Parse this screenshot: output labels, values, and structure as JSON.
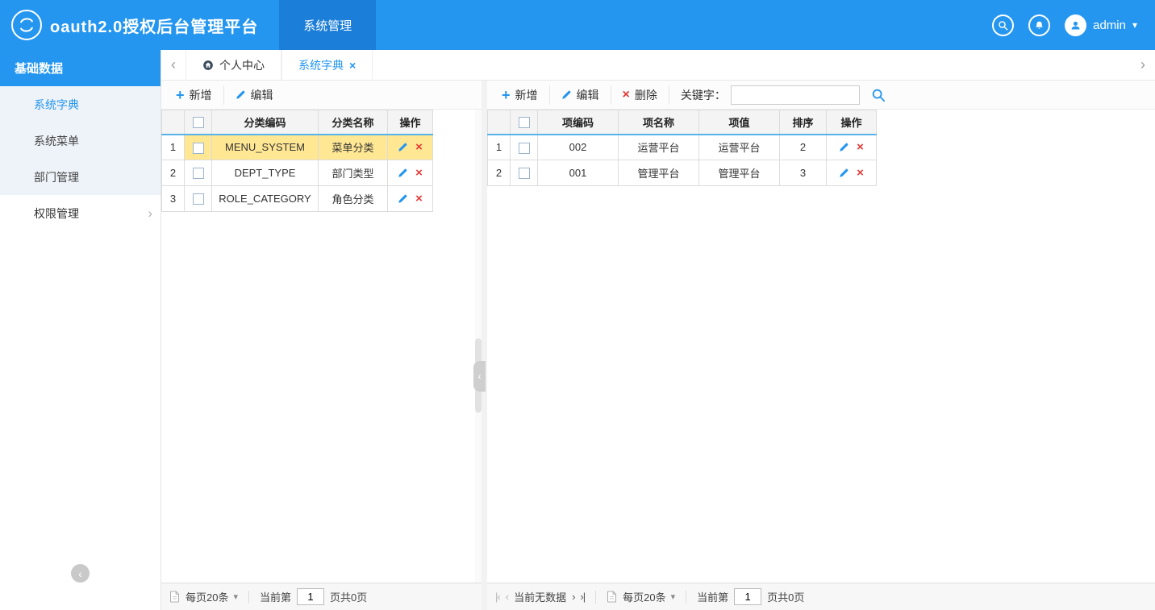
{
  "colors": {
    "header_blue": "#2496f0",
    "active_nav": "#1b7ed8",
    "accent": "#2496f0",
    "danger": "#e53935",
    "selected_row": "#ffe794"
  },
  "icons": {
    "plus": "+",
    "close": "×",
    "delete": "×",
    "caret_down": "▾",
    "chevron_left": "‹",
    "chevron_right": "›",
    "first_page": "|‹",
    "prev_page": "‹",
    "next_page": "›",
    "last_page": "›|"
  },
  "header": {
    "title": "oauth2.0授权后台管理平台",
    "nav": "系统管理",
    "user": "admin"
  },
  "sidebar": {
    "group_basic": "基础数据",
    "item_dict": "系统字典",
    "item_menu": "系统菜单",
    "item_dept": "部门管理",
    "group_perm": "权限管理"
  },
  "tabbar": {
    "home_tab": "个人中心",
    "active_tab": "系统字典"
  },
  "left_panel": {
    "toolbar": {
      "add": "新增",
      "edit": "编辑"
    },
    "table": {
      "headers": {
        "code": "分类编码",
        "name": "分类名称",
        "ops": "操作"
      },
      "rows": [
        {
          "no": "1",
          "code": "MENU_SYSTEM",
          "name": "菜单分类"
        },
        {
          "no": "2",
          "code": "DEPT_TYPE",
          "name": "部门类型"
        },
        {
          "no": "3",
          "code": "ROLE_CATEGORY",
          "name": "角色分类"
        }
      ]
    },
    "pagination": {
      "page_size": "每页20条",
      "current_label": "当前第",
      "page": "1",
      "total_label": "页共0页"
    }
  },
  "right_panel": {
    "toolbar": {
      "add": "新增",
      "edit": "编辑",
      "del": "删除",
      "keyword_label": "关键字："
    },
    "table": {
      "headers": {
        "code": "项编码",
        "name": "项名称",
        "value": "项值",
        "sort": "排序",
        "ops": "操作"
      },
      "rows": [
        {
          "no": "1",
          "code": "002",
          "name": "运营平台",
          "value": "运营平台",
          "sort": "2"
        },
        {
          "no": "2",
          "code": "001",
          "name": "管理平台",
          "value": "管理平台",
          "sort": "3"
        }
      ]
    },
    "pagination": {
      "no_data": "当前无数据",
      "page_size": "每页20条",
      "current_label": "当前第",
      "page": "1",
      "total_label": "页共0页"
    }
  }
}
